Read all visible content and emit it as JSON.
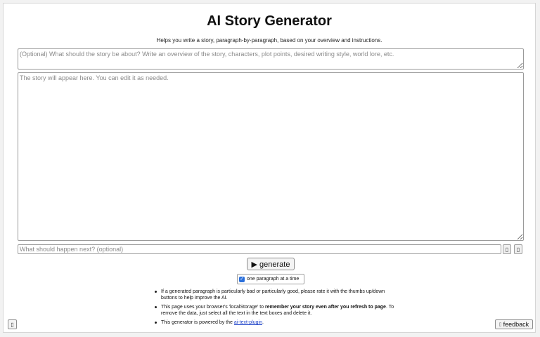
{
  "header": {
    "title": "AI Story Generator",
    "subtitle": "Helps you write a story, paragraph-by-paragraph, based on your overview and instructions."
  },
  "overview": {
    "placeholder": "(Optional) What should the story be about? Write an overview of the story, characters, plot points, desired writing style, world lore, etc."
  },
  "story": {
    "placeholder": "The story will appear here. You can edit it as needed."
  },
  "next_instruction": {
    "placeholder": "What should happen next? (optional)"
  },
  "controls": {
    "generate_label": "▶ generate",
    "one_paragraph_label": "one paragraph at a time",
    "one_paragraph_checked": true
  },
  "notes": {
    "item1": "If a generated paragraph is particularly bad or particularly good, please rate it with the thumbs up/down buttons to help improve the AI.",
    "item2_pre": "This page uses your browser's 'localStorage' to ",
    "item2_bold": "remember your story even after you refresh to page",
    "item2_post": ". To remove the data, just select all the text in the text boxes and delete it.",
    "item3_pre": "This generator is powered by the ",
    "item3_link": "ai-text-plugin",
    "item3_post": "."
  },
  "footer": {
    "feedback_label": "feedback"
  },
  "icons": {
    "up": "thumbs-up-icon",
    "down": "thumbs-down-icon",
    "corner": "menu-icon",
    "feedback": "feedback-icon"
  }
}
